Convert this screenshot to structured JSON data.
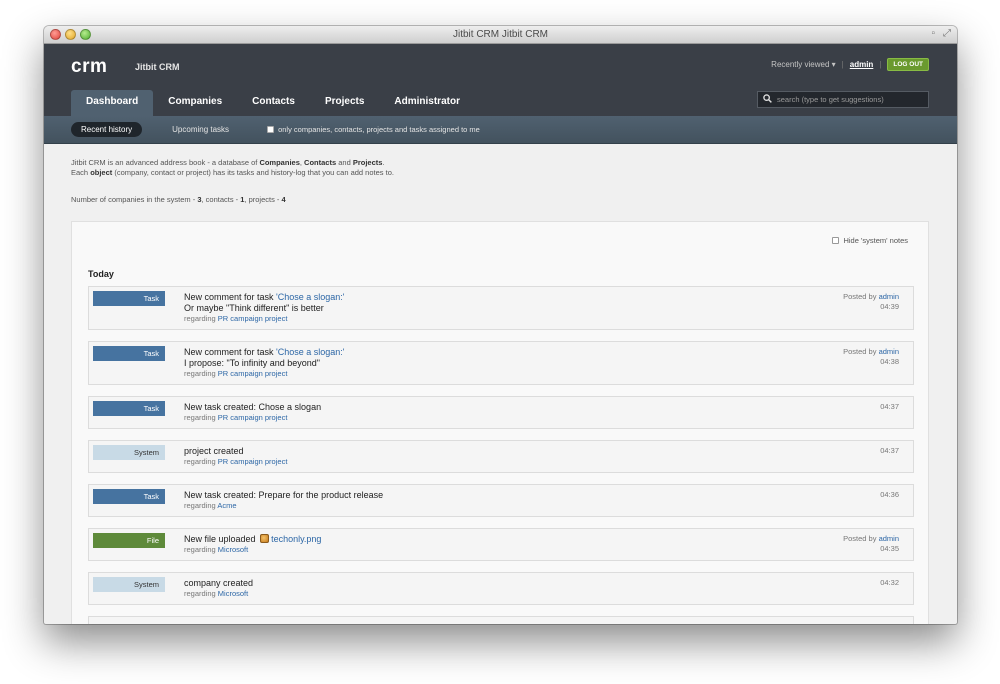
{
  "window": {
    "title": "Jitbit CRM Jitbit CRM"
  },
  "header": {
    "logo": "crm",
    "app_name": "Jitbit CRM",
    "recently_viewed": "Recently viewed ▾",
    "user": "admin",
    "logout": "LOG OUT"
  },
  "tabs": [
    "Dashboard",
    "Companies",
    "Contacts",
    "Projects",
    "Administrator"
  ],
  "search": {
    "placeholder": "search (type to get suggestions)"
  },
  "subnav": {
    "recent_history": "Recent history",
    "upcoming_tasks": "Upcoming tasks",
    "filter_label": "only companies, contacts, projects and tasks assigned to me"
  },
  "intro": {
    "line1_a": "Jitbit CRM is an advanced address book - a database of ",
    "line1_companies": "Companies",
    "line1_sep1": ", ",
    "line1_contacts": "Contacts",
    "line1_and": " and ",
    "line1_projects": "Projects",
    "line1_end": ".",
    "line2_a": "Each ",
    "line2_object": "object",
    "line2_b": " (company, contact or project) has its tasks and history-log that you can add notes to."
  },
  "stats": {
    "prefix": "Number of companies in the system - ",
    "companies": "3",
    "contacts_label": ", contacts - ",
    "contacts": "1",
    "projects_label": ", projects - ",
    "projects": "4"
  },
  "feed": {
    "hide_system_notes": "Hide 'system' notes",
    "day": "Today",
    "items": [
      {
        "type": "Task",
        "line1_prefix": "New comment for task ",
        "line1_link": "'Chose a slogan:'",
        "line2": "Or maybe \"Think different\" is better",
        "regarding_label": "regarding ",
        "regarding_link": "PR campaign project",
        "posted_by": "Posted by ",
        "author": "admin",
        "time": "04:39"
      },
      {
        "type": "Task",
        "line1_prefix": "New comment for task ",
        "line1_link": "'Chose a slogan:'",
        "line2": "I propose: \"To infinity and beyond\"",
        "regarding_label": "regarding ",
        "regarding_link": "PR campaign project",
        "posted_by": "Posted by ",
        "author": "admin",
        "time": "04:38"
      },
      {
        "type": "Task",
        "line1": "New task created: Chose a slogan",
        "regarding_label": "regarding ",
        "regarding_link": "PR campaign project",
        "time": "04:37"
      },
      {
        "type": "System",
        "line1": "project created",
        "regarding_label": "regarding ",
        "regarding_link": "PR campaign project",
        "time": "04:37"
      },
      {
        "type": "Task",
        "line1": "New task created: Prepare for the product release",
        "regarding_label": "regarding ",
        "regarding_link": "Acme",
        "time": "04:36"
      },
      {
        "type": "File",
        "line1_prefix": "New file uploaded ",
        "file_link": "techonly.png",
        "regarding_label": "regarding ",
        "regarding_link": "Microsoft",
        "posted_by": "Posted by ",
        "author": "admin",
        "time": "04:35"
      },
      {
        "type": "System",
        "line1": "company created",
        "regarding_label": "regarding ",
        "regarding_link": "Microsoft",
        "time": "04:32"
      }
    ]
  }
}
